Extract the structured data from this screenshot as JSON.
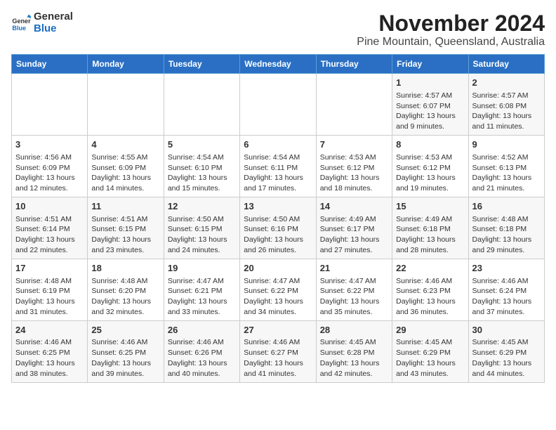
{
  "header": {
    "logo_general": "General",
    "logo_blue": "Blue",
    "month_year": "November 2024",
    "location": "Pine Mountain, Queensland, Australia"
  },
  "days_of_week": [
    "Sunday",
    "Monday",
    "Tuesday",
    "Wednesday",
    "Thursday",
    "Friday",
    "Saturday"
  ],
  "weeks": [
    [
      {
        "day": "",
        "info": ""
      },
      {
        "day": "",
        "info": ""
      },
      {
        "day": "",
        "info": ""
      },
      {
        "day": "",
        "info": ""
      },
      {
        "day": "",
        "info": ""
      },
      {
        "day": "1",
        "info": "Sunrise: 4:57 AM\nSunset: 6:07 PM\nDaylight: 13 hours and 9 minutes."
      },
      {
        "day": "2",
        "info": "Sunrise: 4:57 AM\nSunset: 6:08 PM\nDaylight: 13 hours and 11 minutes."
      }
    ],
    [
      {
        "day": "3",
        "info": "Sunrise: 4:56 AM\nSunset: 6:09 PM\nDaylight: 13 hours and 12 minutes."
      },
      {
        "day": "4",
        "info": "Sunrise: 4:55 AM\nSunset: 6:09 PM\nDaylight: 13 hours and 14 minutes."
      },
      {
        "day": "5",
        "info": "Sunrise: 4:54 AM\nSunset: 6:10 PM\nDaylight: 13 hours and 15 minutes."
      },
      {
        "day": "6",
        "info": "Sunrise: 4:54 AM\nSunset: 6:11 PM\nDaylight: 13 hours and 17 minutes."
      },
      {
        "day": "7",
        "info": "Sunrise: 4:53 AM\nSunset: 6:12 PM\nDaylight: 13 hours and 18 minutes."
      },
      {
        "day": "8",
        "info": "Sunrise: 4:53 AM\nSunset: 6:12 PM\nDaylight: 13 hours and 19 minutes."
      },
      {
        "day": "9",
        "info": "Sunrise: 4:52 AM\nSunset: 6:13 PM\nDaylight: 13 hours and 21 minutes."
      }
    ],
    [
      {
        "day": "10",
        "info": "Sunrise: 4:51 AM\nSunset: 6:14 PM\nDaylight: 13 hours and 22 minutes."
      },
      {
        "day": "11",
        "info": "Sunrise: 4:51 AM\nSunset: 6:15 PM\nDaylight: 13 hours and 23 minutes."
      },
      {
        "day": "12",
        "info": "Sunrise: 4:50 AM\nSunset: 6:15 PM\nDaylight: 13 hours and 24 minutes."
      },
      {
        "day": "13",
        "info": "Sunrise: 4:50 AM\nSunset: 6:16 PM\nDaylight: 13 hours and 26 minutes."
      },
      {
        "day": "14",
        "info": "Sunrise: 4:49 AM\nSunset: 6:17 PM\nDaylight: 13 hours and 27 minutes."
      },
      {
        "day": "15",
        "info": "Sunrise: 4:49 AM\nSunset: 6:18 PM\nDaylight: 13 hours and 28 minutes."
      },
      {
        "day": "16",
        "info": "Sunrise: 4:48 AM\nSunset: 6:18 PM\nDaylight: 13 hours and 29 minutes."
      }
    ],
    [
      {
        "day": "17",
        "info": "Sunrise: 4:48 AM\nSunset: 6:19 PM\nDaylight: 13 hours and 31 minutes."
      },
      {
        "day": "18",
        "info": "Sunrise: 4:48 AM\nSunset: 6:20 PM\nDaylight: 13 hours and 32 minutes."
      },
      {
        "day": "19",
        "info": "Sunrise: 4:47 AM\nSunset: 6:21 PM\nDaylight: 13 hours and 33 minutes."
      },
      {
        "day": "20",
        "info": "Sunrise: 4:47 AM\nSunset: 6:22 PM\nDaylight: 13 hours and 34 minutes."
      },
      {
        "day": "21",
        "info": "Sunrise: 4:47 AM\nSunset: 6:22 PM\nDaylight: 13 hours and 35 minutes."
      },
      {
        "day": "22",
        "info": "Sunrise: 4:46 AM\nSunset: 6:23 PM\nDaylight: 13 hours and 36 minutes."
      },
      {
        "day": "23",
        "info": "Sunrise: 4:46 AM\nSunset: 6:24 PM\nDaylight: 13 hours and 37 minutes."
      }
    ],
    [
      {
        "day": "24",
        "info": "Sunrise: 4:46 AM\nSunset: 6:25 PM\nDaylight: 13 hours and 38 minutes."
      },
      {
        "day": "25",
        "info": "Sunrise: 4:46 AM\nSunset: 6:25 PM\nDaylight: 13 hours and 39 minutes."
      },
      {
        "day": "26",
        "info": "Sunrise: 4:46 AM\nSunset: 6:26 PM\nDaylight: 13 hours and 40 minutes."
      },
      {
        "day": "27",
        "info": "Sunrise: 4:46 AM\nSunset: 6:27 PM\nDaylight: 13 hours and 41 minutes."
      },
      {
        "day": "28",
        "info": "Sunrise: 4:45 AM\nSunset: 6:28 PM\nDaylight: 13 hours and 42 minutes."
      },
      {
        "day": "29",
        "info": "Sunrise: 4:45 AM\nSunset: 6:29 PM\nDaylight: 13 hours and 43 minutes."
      },
      {
        "day": "30",
        "info": "Sunrise: 4:45 AM\nSunset: 6:29 PM\nDaylight: 13 hours and 44 minutes."
      }
    ]
  ]
}
